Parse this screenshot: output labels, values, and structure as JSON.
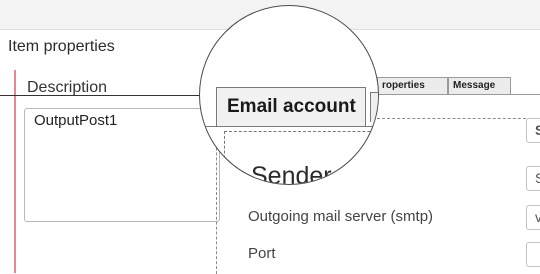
{
  "window": {
    "section_title": "Item properties"
  },
  "description": {
    "label": "Description",
    "value": "OutputPost1"
  },
  "tabs": {
    "active_label": "Email account",
    "properties_label": "roperties",
    "message_label": "Message"
  },
  "email_account": {
    "group_title": "Sender",
    "fields": [
      {
        "label": "Outgoing mail server (smtp)",
        "value_visible": "v"
      },
      {
        "label": "Port",
        "value_visible": ""
      }
    ],
    "top_field_visible": "S",
    "first_input_visible": "S"
  },
  "colors": {
    "accent_rule": "#e98a8a",
    "tab_border": "#7a7a7a",
    "background": "#ffffff"
  }
}
